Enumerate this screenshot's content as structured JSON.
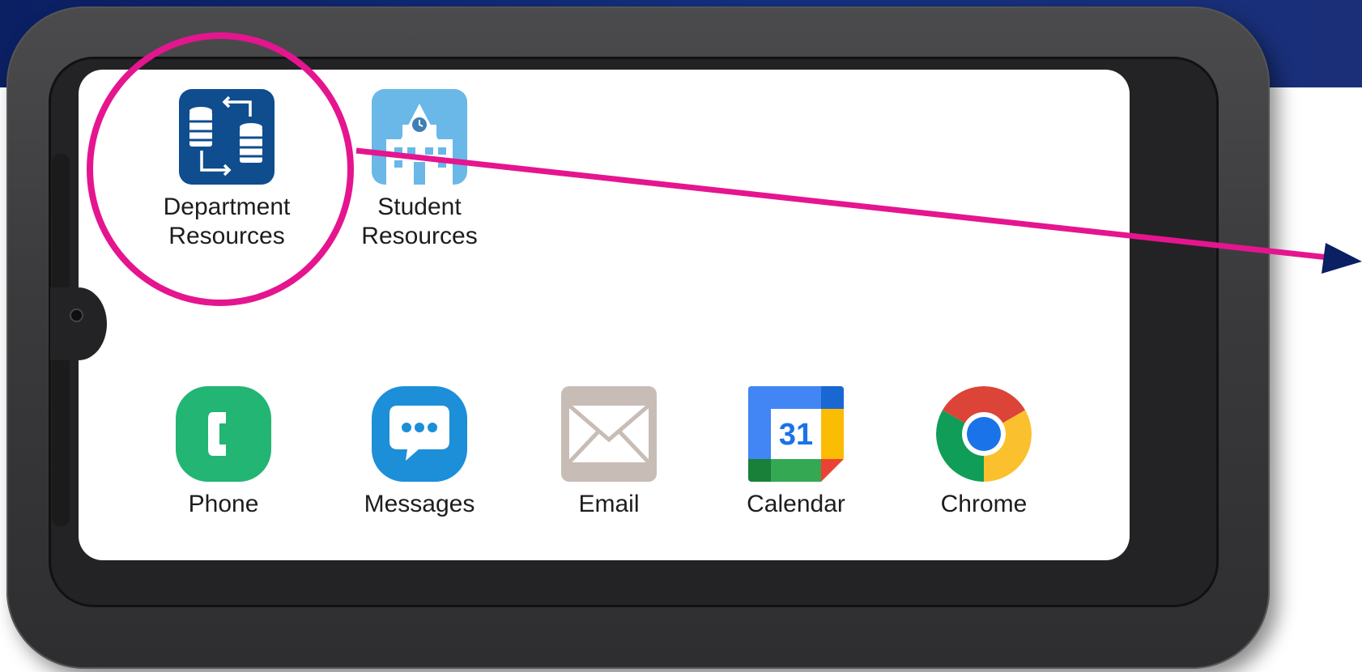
{
  "home_screen": {
    "top_apps": [
      {
        "label": "Department\nResources",
        "icon": "database-transfer-icon"
      },
      {
        "label": "Student\nResources",
        "icon": "school-building-icon"
      }
    ],
    "dock_apps": [
      {
        "label": "Phone",
        "icon": "phone-icon"
      },
      {
        "label": "Messages",
        "icon": "messages-icon"
      },
      {
        "label": "Email",
        "icon": "envelope-icon"
      },
      {
        "label": "Calendar",
        "icon": "calendar-icon",
        "badge": "31"
      },
      {
        "label": "Chrome",
        "icon": "chrome-icon"
      }
    ]
  },
  "colors": {
    "callout": "#e5158f",
    "department_icon_bg": "#0f4d8f",
    "student_icon_bg": "#69b8e8",
    "phone_green": "#22b573",
    "messages_blue": "#1c8fd8",
    "email_gray": "#c7bdb6",
    "page_band": "#0b1f63"
  }
}
